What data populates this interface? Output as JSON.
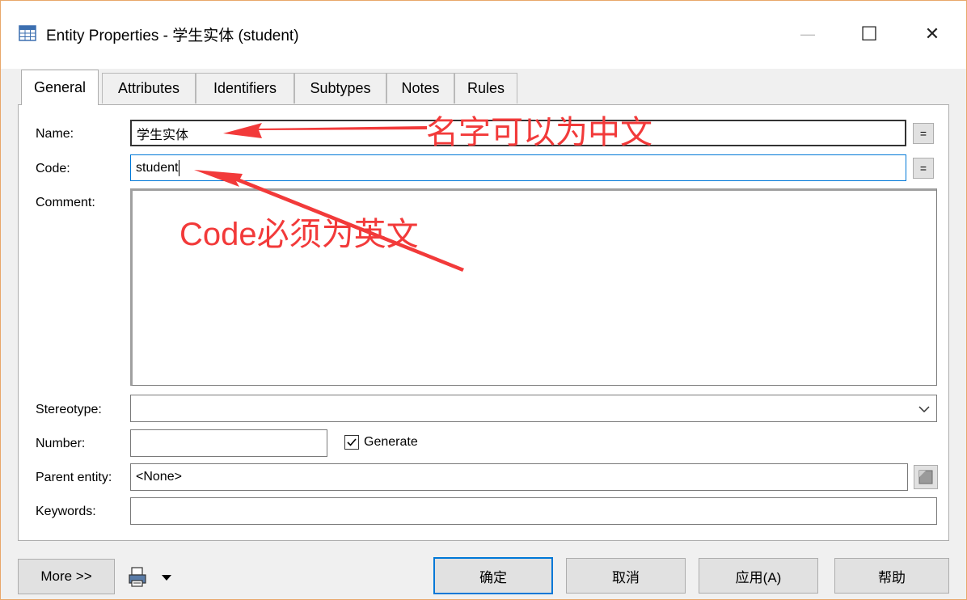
{
  "window": {
    "title": "Entity Properties - 学生实体 (student)",
    "controls": {
      "minimize": "—",
      "maximize": "☐",
      "close": "✕"
    }
  },
  "tabs": [
    {
      "label": "General",
      "active": true
    },
    {
      "label": "Attributes",
      "active": false
    },
    {
      "label": "Identifiers",
      "active": false
    },
    {
      "label": "Subtypes",
      "active": false
    },
    {
      "label": "Notes",
      "active": false
    },
    {
      "label": "Rules",
      "active": false
    }
  ],
  "form": {
    "name_label": "Name:",
    "name_value": "学生实体",
    "code_label": "Code:",
    "code_value": "student",
    "comment_label": "Comment:",
    "comment_value": "",
    "stereotype_label": "Stereotype:",
    "stereotype_value": "",
    "number_label": "Number:",
    "number_value": "",
    "generate_label": "Generate",
    "generate_checked": true,
    "parent_label": "Parent entity:",
    "parent_value": "<None>",
    "keywords_label": "Keywords:",
    "keywords_value": "",
    "equal_button": "="
  },
  "annotations": {
    "name_note": "名字可以为中文",
    "code_note": "Code必须为英文",
    "color": "#f23a3a"
  },
  "buttons": {
    "more": "More >>",
    "ok": "确定",
    "cancel": "取消",
    "apply": "应用(A)",
    "help": "帮助"
  },
  "colors": {
    "accent": "#0078d7",
    "dialog_bg": "#f0f0f0",
    "window_border": "#e8a76a"
  },
  "icons": {
    "title": "entity-table-icon",
    "print": "print-icon",
    "parent_browse": "browse-icon"
  }
}
